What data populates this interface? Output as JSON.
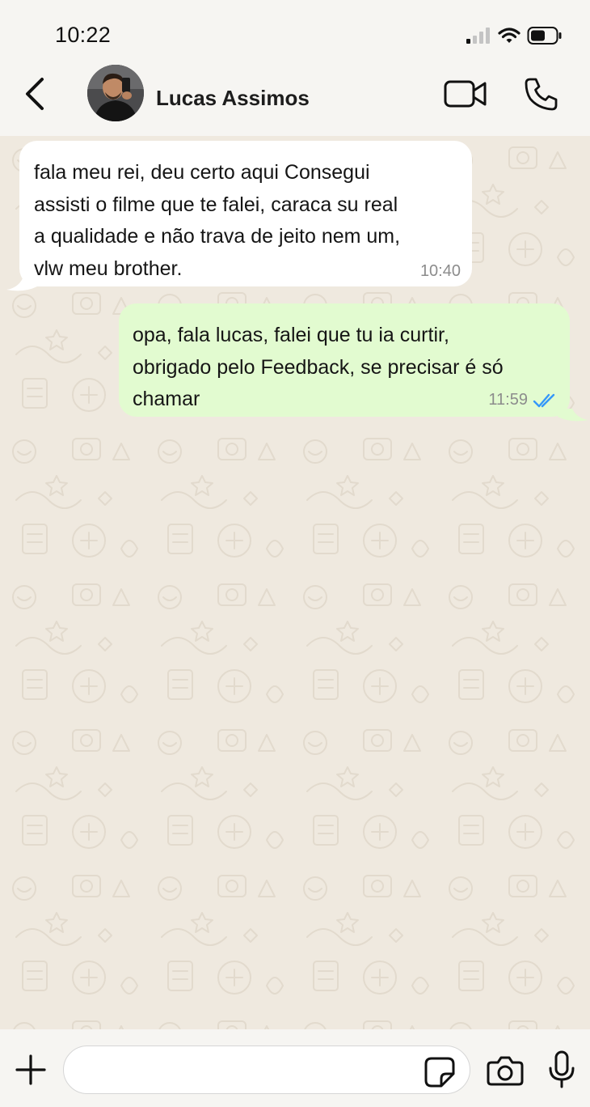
{
  "status_bar": {
    "time": "10:22",
    "icons": [
      "signal-icon",
      "wifi-icon",
      "battery-icon"
    ]
  },
  "header": {
    "back_icon": "chevron-left-icon",
    "contact_name": "Lucas Assimos",
    "actions": [
      "video-call-icon",
      "phone-icon"
    ]
  },
  "messages": [
    {
      "direction": "incoming",
      "lines": [
        "fala meu rei, deu certo aqui Consegui",
        "assisti o filme que te falei, caraca su real",
        "a qualidade e não trava de jeito nem um,",
        "vlw meu brother."
      ],
      "time": "10:40"
    },
    {
      "direction": "outgoing",
      "lines": [
        "opa, fala lucas, falei que tu ia curtir,",
        "obrigado pelo Feedback, se precisar é só",
        "chamar"
      ],
      "time": "11:59",
      "status": "read"
    }
  ],
  "input_bar": {
    "message_placeholder": "",
    "icons": [
      "plus-icon",
      "sticker-icon",
      "camera-icon",
      "microphone-icon"
    ]
  },
  "colors": {
    "chat_background": "#efe9df",
    "incoming_bubble": "#ffffff",
    "outgoing_bubble": "#e2fbd0",
    "read_ticks": "#3497f9",
    "timestamp": "#8c8c8c"
  }
}
